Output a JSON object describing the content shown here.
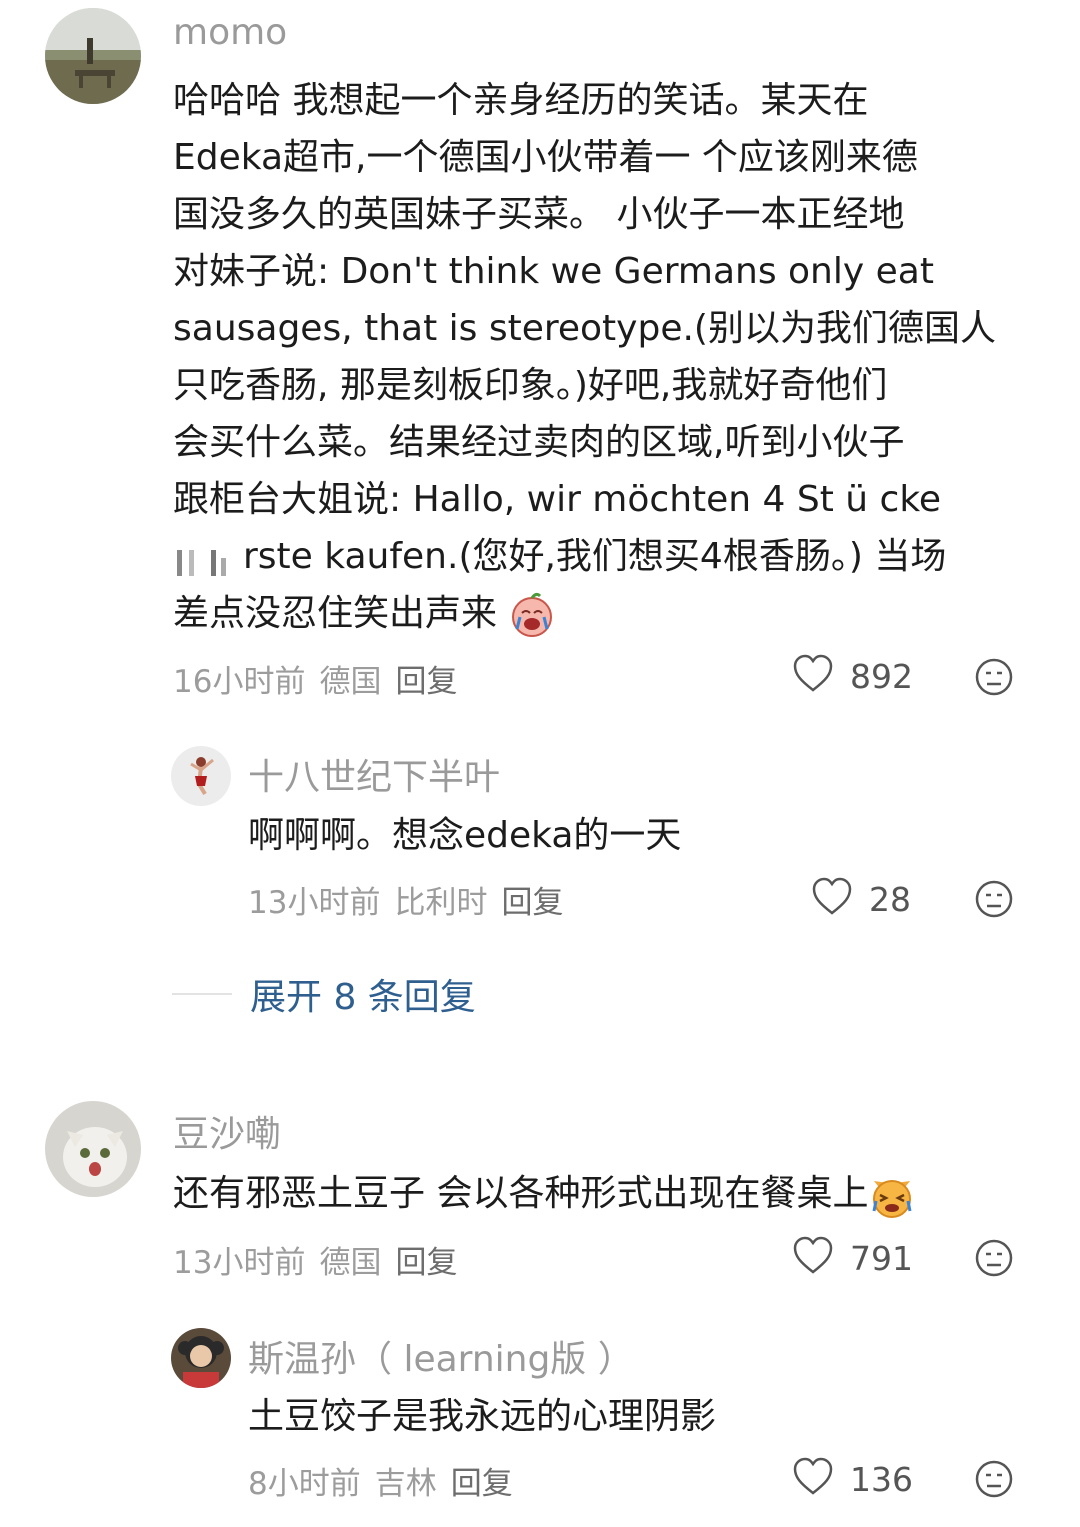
{
  "comments": [
    {
      "user": "momo",
      "text_lines": [
        "哈哈哈 我想起一个亲身经历的笑话。某天在",
        "Edeka超市,一个德国小伙带着一 个应该刚来德",
        "国没多久的英国妹子买菜。 小伙子一本正经地",
        "对妹子说: Don't think we Germans only eat",
        "sausages, that is stereotype.(别以为我们德国人",
        "只吃香肠, 那是刻板印象。)好吧,我就好奇他们",
        "会买什么菜。结果经过卖肉的区域,听到小伙子",
        "跟柜台大姐说: Hallo, wir möchten 4 St ü cke",
        "rste kaufen.(您好,我们想买4根香肠。) 当场",
        "差点没忍住笑出声来"
      ],
      "time": "16小时前",
      "location": "德国",
      "reply_label": "回复",
      "likes": "892",
      "icons": {
        "like": "heart-icon",
        "dislike": "dislike-face-icon",
        "emoji": "crying-laughing-emoji"
      }
    },
    {
      "user": "十八世纪下半叶",
      "text": "啊啊啊。想念edeka的一天",
      "time": "13小时前",
      "location": "比利时",
      "reply_label": "回复",
      "likes": "28"
    },
    {
      "expand_label": "展开 8 条回复"
    },
    {
      "user": "豆沙嘞",
      "text": "还有邪恶土豆子 会以各种形式出现在餐桌上",
      "time": "13小时前",
      "location": "德国",
      "reply_label": "回复",
      "likes": "791"
    },
    {
      "user": "斯温孙（ learning版 ）",
      "text": "土豆饺子是我永远的心理阴影",
      "time": "8小时前",
      "location": "吉林",
      "reply_label": "回复",
      "likes": "136"
    }
  ],
  "colors": {
    "accent": "#2f5f8f",
    "meta": "#9c9c9c",
    "name": "#9a9a9a"
  }
}
